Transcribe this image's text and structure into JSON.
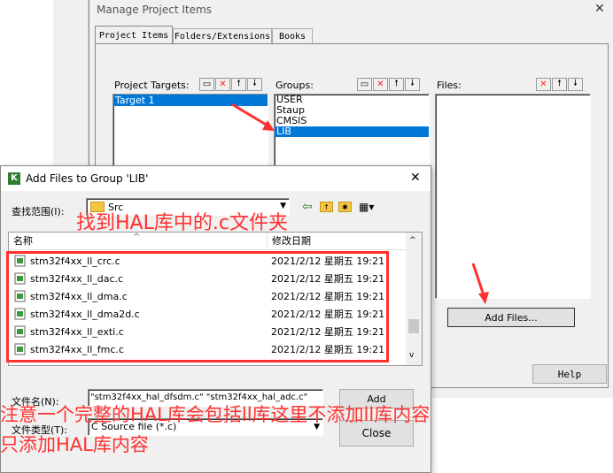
{
  "manage_dialog": {
    "title": "Manage Project Items",
    "tabs": [
      "Project Items",
      "Folders/Extensions",
      "Books"
    ],
    "project_targets_label": "Project Targets:",
    "targets": [
      "Target 1"
    ],
    "groups_label": "Groups:",
    "groups": [
      "USER",
      "Staup",
      "CMSIS",
      "LIB"
    ],
    "files_label": "Files:",
    "add_files_button": "Add Files...",
    "help_button": "Help"
  },
  "add_dialog": {
    "title": "Add Files to Group 'LIB'",
    "close_symbol": "✕",
    "look_in_label": "查找范围(I):",
    "look_in_value": "Src",
    "col_name": "名称",
    "col_modified": "修改日期",
    "files": [
      {
        "name": "stm32f4xx_ll_crc.c",
        "date": "2021/2/12 星期五 19:21"
      },
      {
        "name": "stm32f4xx_ll_dac.c",
        "date": "2021/2/12 星期五 19:21"
      },
      {
        "name": "stm32f4xx_ll_dma.c",
        "date": "2021/2/12 星期五 19:21"
      },
      {
        "name": "stm32f4xx_ll_dma2d.c",
        "date": "2021/2/12 星期五 19:21"
      },
      {
        "name": "stm32f4xx_ll_exti.c",
        "date": "2021/2/12 星期五 19:21"
      },
      {
        "name": "stm32f4xx_ll_fmc.c",
        "date": "2021/2/12 星期五 19:21"
      }
    ],
    "filename_label": "文件名(N):",
    "filename_value": "\"stm32f4xx_hal_dfsdm.c\" \"stm32f4xx_hal_adc.c\"",
    "filetype_label": "文件类型(T):",
    "filetype_value": "C Source file (*.c)",
    "add_button": "Add",
    "close_button": "Close"
  },
  "annotations": {
    "top": "找到HAL库中的.c文件夹",
    "bottom_line1": "注意一个完整的HAL库会包括ll库这里不添加ll库内容",
    "bottom_line2": "只添加HAL库内容"
  },
  "colors": {
    "selection": "#0078d7",
    "annotation": "#ff3030"
  }
}
